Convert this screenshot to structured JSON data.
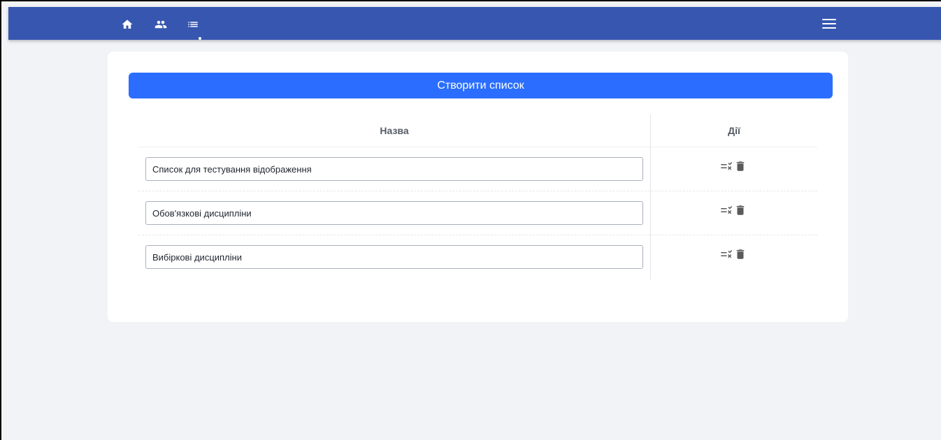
{
  "nav": {
    "icons": [
      "home-icon",
      "people-icon",
      "list-icon"
    ],
    "active": "list-icon",
    "menu_icon": "hamburger-menu-icon"
  },
  "main": {
    "create_button_label": "Створити список",
    "table": {
      "headers": {
        "name": "Назва",
        "actions": "Дії"
      },
      "rows": [
        {
          "name": "Список для тестування відображення"
        },
        {
          "name": "Обов'язкові дисципліни"
        },
        {
          "name": "Вибіркові дисципліни"
        }
      ],
      "row_actions": [
        "edit-list-icon",
        "delete-icon"
      ]
    }
  },
  "colors": {
    "topbar": "#3656b0",
    "primary_button": "#2b6eff",
    "background": "#f2f3f7"
  }
}
